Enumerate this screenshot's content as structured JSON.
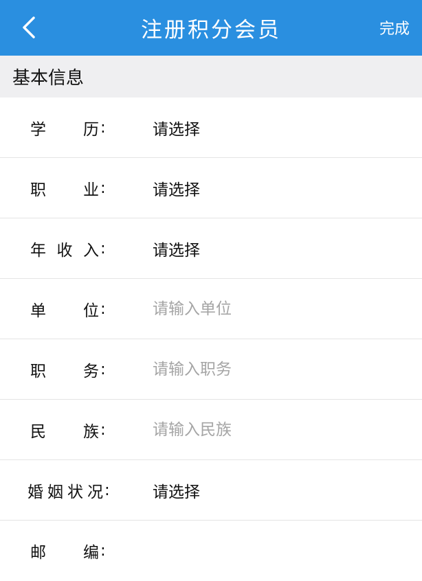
{
  "header": {
    "title": "注册积分会员",
    "done_label": "完成",
    "back_icon": "chevron-left-icon",
    "bg_color": "#2a8fe0"
  },
  "section": {
    "title": "基本信息"
  },
  "fields": [
    {
      "label": "学历",
      "chars": [
        "学",
        "历"
      ],
      "value": "请选择",
      "type": "select"
    },
    {
      "label": "职业",
      "chars": [
        "职",
        "业"
      ],
      "value": "请选择",
      "type": "select"
    },
    {
      "label": "年收入",
      "chars": [
        "年",
        "收",
        "入"
      ],
      "value": "请选择",
      "type": "select"
    },
    {
      "label": "单位",
      "chars": [
        "单",
        "位"
      ],
      "placeholder": "请输入单位",
      "type": "input"
    },
    {
      "label": "职务",
      "chars": [
        "职",
        "务"
      ],
      "placeholder": "请输入职务",
      "type": "input"
    },
    {
      "label": "民族",
      "chars": [
        "民",
        "族"
      ],
      "placeholder": "请输入民族",
      "type": "input"
    },
    {
      "label": "婚姻状况",
      "chars": [
        "婚",
        "姻",
        "状",
        "况"
      ],
      "value": "请选择",
      "type": "select"
    },
    {
      "label": "邮编",
      "chars": [
        "邮",
        "编"
      ],
      "placeholder": "",
      "type": "input"
    }
  ]
}
